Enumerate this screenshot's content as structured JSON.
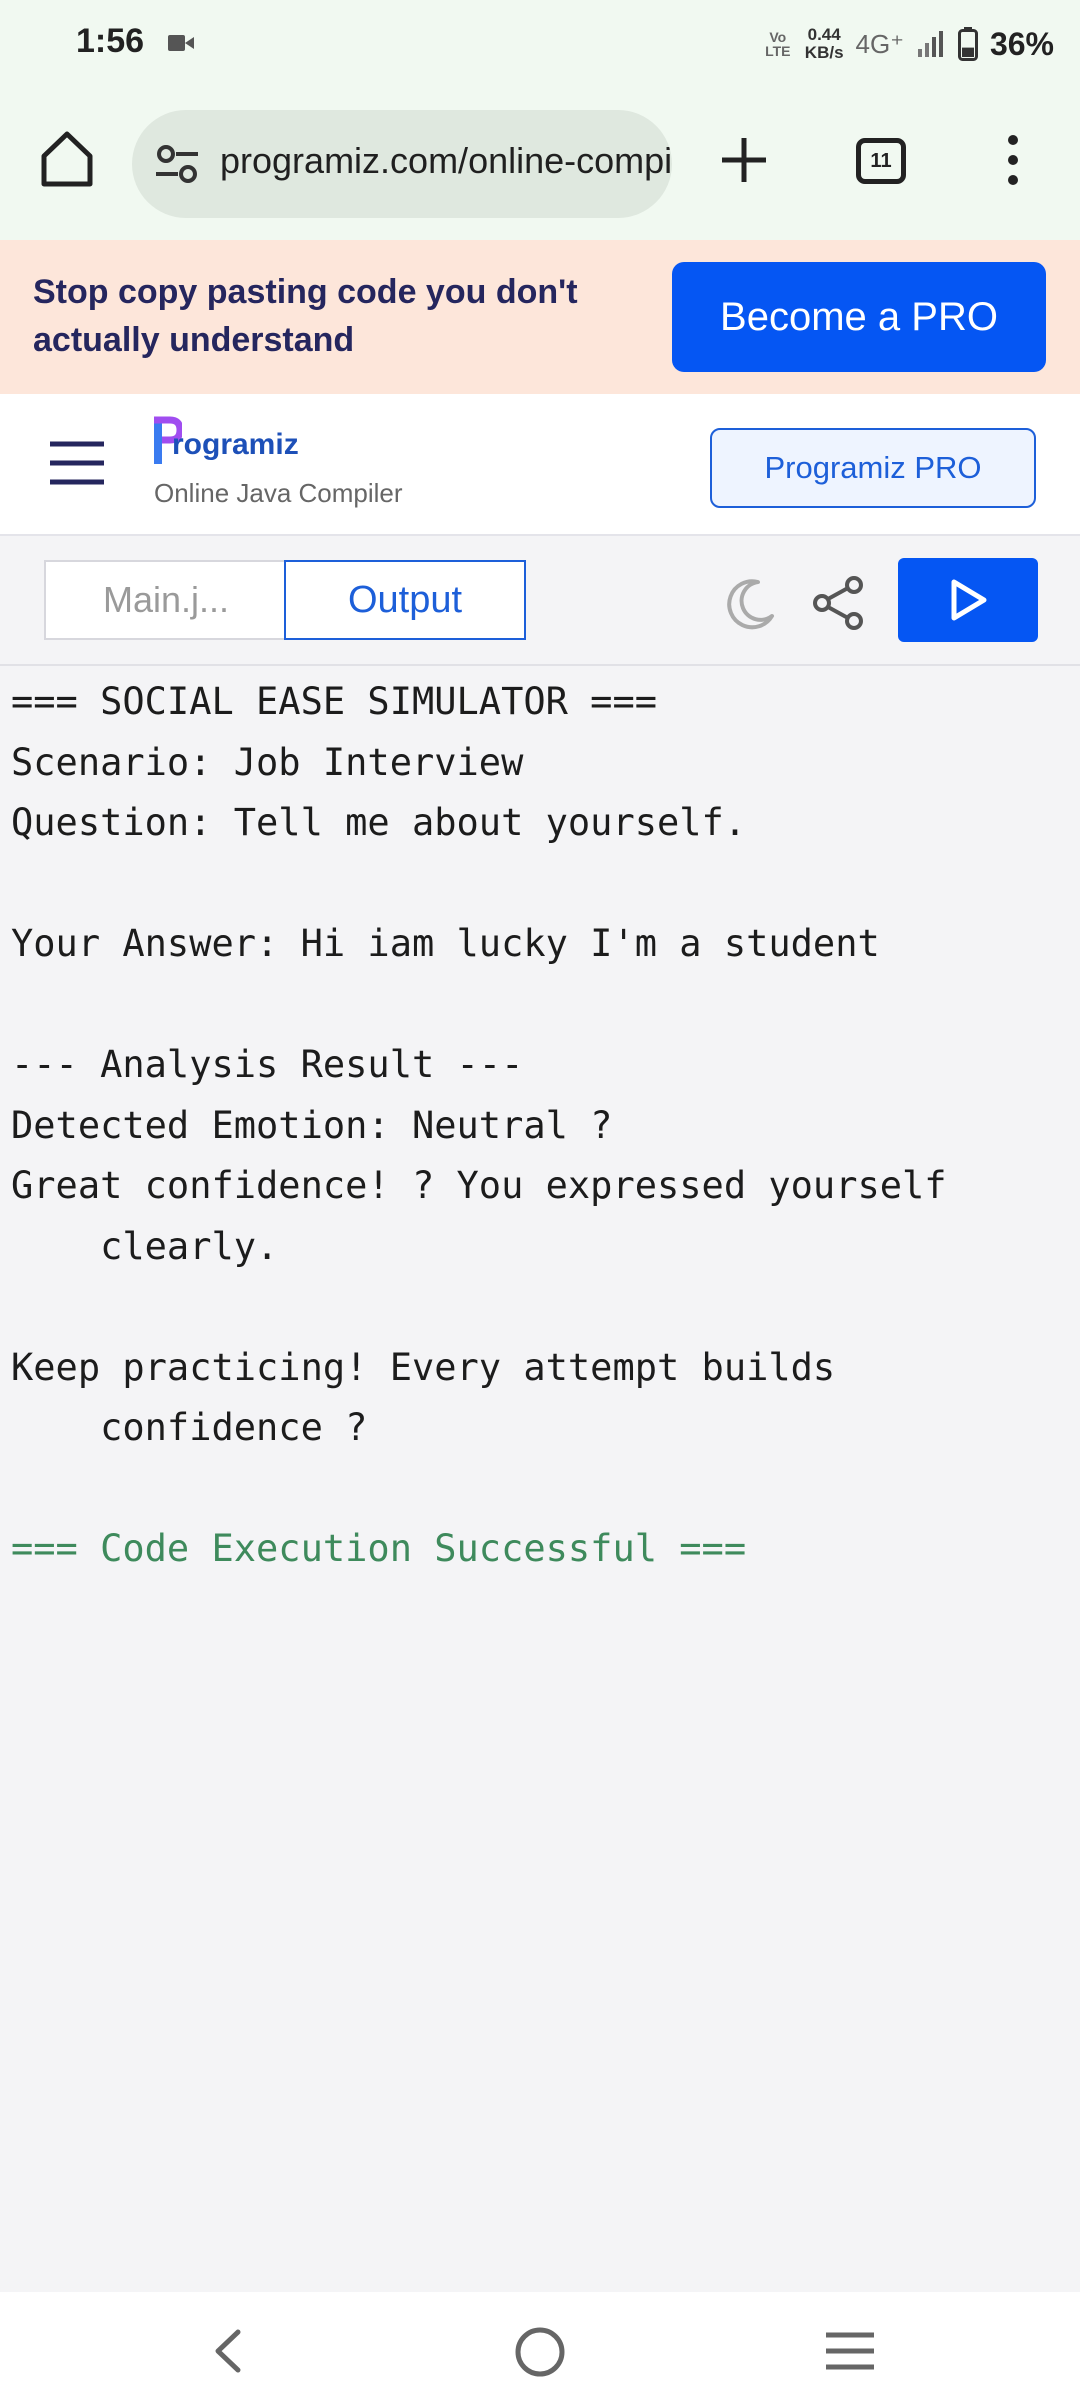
{
  "status_bar": {
    "time": "1:56",
    "volte": "Vo LTE",
    "net_speed_value": "0.44",
    "net_speed_unit": "KB/s",
    "network": "4G⁺",
    "battery": "36%",
    "battery_level": 0.36
  },
  "browser": {
    "url": "programiz.com/online-compiler/java",
    "tab_count": "11"
  },
  "promo": {
    "text": "Stop copy pasting code you don't actually understand",
    "button": "Become a PRO"
  },
  "header": {
    "logo_text": "rogramiz",
    "subtitle": "Online Java Compiler",
    "pro_button": "Programiz PRO"
  },
  "toolbar": {
    "file_tab": "Main.j...",
    "output_tab": "Output"
  },
  "output": {
    "lines": [
      "=== SOCIAL EASE SIMULATOR ===",
      "Scenario: Job Interview",
      "Question: Tell me about yourself.",
      "",
      "Your Answer: Hi iam lucky I'm a student",
      "",
      "--- Analysis Result ---",
      "Detected Emotion: Neutral ?",
      "Great confidence! ? You expressed yourself",
      "    clearly.",
      "",
      "Keep practicing! Every attempt builds",
      "    confidence ?",
      ""
    ],
    "success": "=== Code Execution Successful ==="
  },
  "colors": {
    "accent": "#0556f3",
    "promo_bg": "#fde6da",
    "success": "#3e8a5c"
  }
}
